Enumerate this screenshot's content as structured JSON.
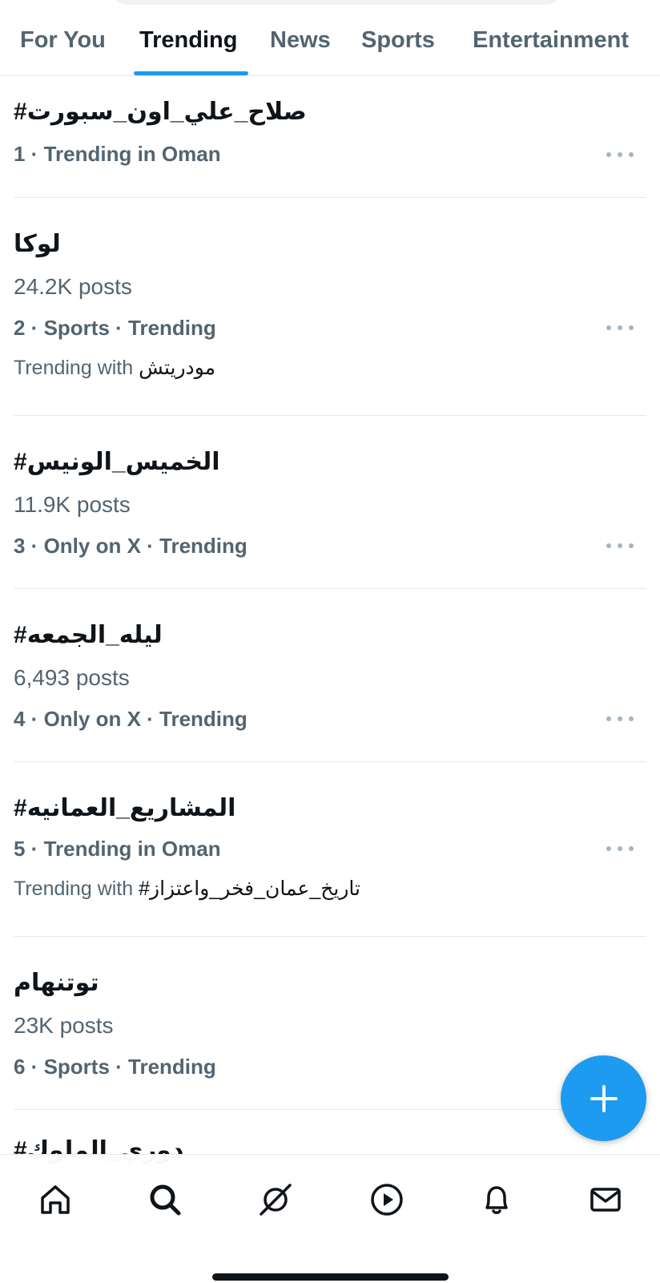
{
  "tabs": [
    {
      "label": "For You"
    },
    {
      "label": "Trending"
    },
    {
      "label": "News"
    },
    {
      "label": "Sports"
    },
    {
      "label": "Entertainment"
    }
  ],
  "active_tab": "Trending",
  "trends": [
    {
      "name": "#صلاح_علي_اون_سبورت",
      "posts": "",
      "meta": "1 · Trending in Oman",
      "with_label": "",
      "with_topic": ""
    },
    {
      "name": "لوكا",
      "posts": "24.2K posts",
      "meta": "2 · Sports · Trending",
      "with_label": "Trending with",
      "with_topic": "مودريتش"
    },
    {
      "name": "#الخميس_الونيس",
      "posts": "11.9K posts",
      "meta": "3 · Only on X · Trending",
      "with_label": "",
      "with_topic": ""
    },
    {
      "name": "#ليله_الجمعه",
      "posts": "6,493 posts",
      "meta": "4 · Only on X · Trending",
      "with_label": "",
      "with_topic": ""
    },
    {
      "name": "#المشاريع_العمانيه",
      "posts": "",
      "meta": "5 · Trending in Oman",
      "with_label": "Trending with",
      "with_topic": "#تاريخ_عمان_فخر_واعتزاز"
    },
    {
      "name": "توتنهام",
      "posts": "23K posts",
      "meta": "6 · Sports · Trending",
      "with_label": "",
      "with_topic": ""
    }
  ],
  "peek_trend": "#دوري_الملوك",
  "colors": {
    "accent": "#1d9bf0",
    "text": "#0f1419",
    "secondary": "#536471",
    "divider": "#e4e7ea"
  },
  "icons": {
    "fab": "plus-icon",
    "nav": [
      "home-icon",
      "search-icon",
      "grok-icon",
      "play-icon",
      "bell-icon",
      "mail-icon"
    ]
  }
}
